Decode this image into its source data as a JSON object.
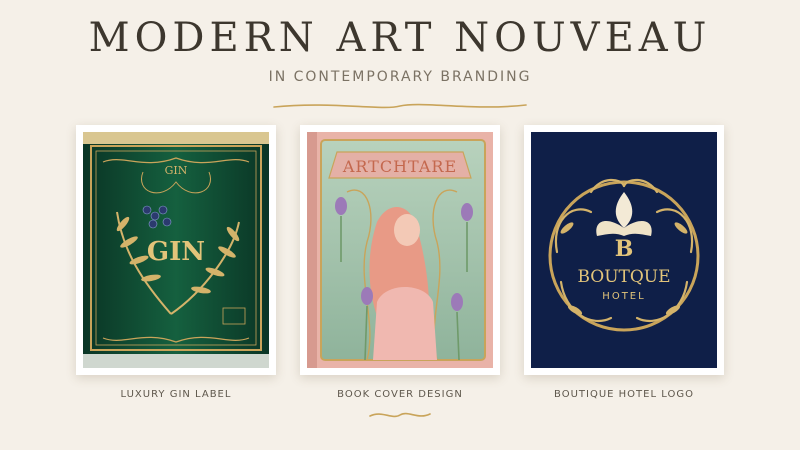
{
  "header": {
    "title": "MODERN ART NOUVEAU",
    "subtitle": "IN CONTEMPORARY BRANDING"
  },
  "cards": [
    {
      "caption": "LUXURY GIN LABEL",
      "artwork_text": [
        "GIN",
        "GIN"
      ]
    },
    {
      "caption": "BOOK COVER DESIGN",
      "artwork_text": [
        "ARTCHTARE"
      ]
    },
    {
      "caption": "BOUTIQUE HOTEL LOGO",
      "artwork_text": [
        "B",
        "BOUTQUE",
        "HOTEL"
      ]
    }
  ],
  "colors": {
    "background": "#f5f0e8",
    "gold": "#c9a45a",
    "gin_green": "#0f4a32",
    "navy": "#0f1f48",
    "book_teal": "#9fbfa9",
    "book_pink": "#e6a6a2"
  }
}
